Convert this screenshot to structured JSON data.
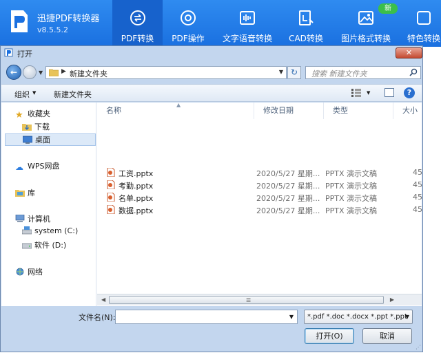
{
  "app": {
    "name": "迅捷PDF转换器",
    "version": "v8.5.5.2",
    "new_badge": "新",
    "tools": [
      {
        "label": "PDF转换",
        "icon": "convert-icon",
        "active": true
      },
      {
        "label": "PDF操作",
        "icon": "gear-icon",
        "active": false
      },
      {
        "label": "文字语音转换",
        "icon": "voice-wave-icon",
        "active": false
      },
      {
        "label": "CAD转换",
        "icon": "cad-icon",
        "active": false
      },
      {
        "label": "图片格式转换",
        "icon": "image-icon",
        "active": false
      },
      {
        "label": "特色转换",
        "icon": "special-icon",
        "active": false
      }
    ]
  },
  "dialog": {
    "title": "打开",
    "close": "✕",
    "address": {
      "path": "新建文件夹"
    },
    "search": {
      "placeholder": "搜索 新建文件夹"
    },
    "commands": {
      "organize": "组织",
      "new_folder": "新建文件夹"
    },
    "nav": {
      "favorites": "收藏夹",
      "downloads": "下载",
      "desktop": "桌面",
      "wps": "WPS网盘",
      "library": "库",
      "computer": "计算机",
      "drive_c": "system (C:)",
      "drive_d": "软件 (D:)",
      "network": "网络"
    },
    "columns": {
      "name": "名称",
      "date": "修改日期",
      "type": "类型",
      "size": "大小"
    },
    "files": [
      {
        "name": "工资.pptx",
        "date": "2020/5/27 星期...",
        "type": "PPTX 演示文稿",
        "size": "45"
      },
      {
        "name": "考勤.pptx",
        "date": "2020/5/27 星期...",
        "type": "PPTX 演示文稿",
        "size": "45"
      },
      {
        "name": "名单.pptx",
        "date": "2020/5/27 星期...",
        "type": "PPTX 演示文稿",
        "size": "45"
      },
      {
        "name": "数据.pptx",
        "date": "2020/5/27 星期...",
        "type": "PPTX 演示文稿",
        "size": "45"
      }
    ],
    "filename_label": "文件名(N):",
    "filename_value": "",
    "filetype": "*.pdf *.doc *.docx *.ppt *.ppt",
    "open_button": "打开(O)",
    "cancel_button": "取消"
  },
  "colors": {
    "brand": "#1a70e0",
    "active_tab": "#1762cc",
    "new_badge": "#3bbf4a"
  }
}
